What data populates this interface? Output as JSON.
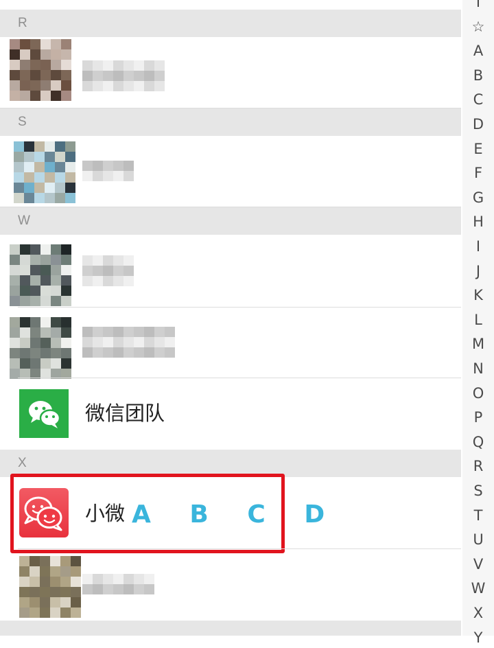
{
  "sections": [
    {
      "letter": "R"
    },
    {
      "letter": "S"
    },
    {
      "letter": "W"
    },
    {
      "letter": "X"
    }
  ],
  "contacts": {
    "wechat_team": {
      "name": "微信团队"
    },
    "xiaowei": {
      "name": "小微",
      "overlay": "A B C D"
    }
  },
  "index_bar": {
    "letters": [
      "I",
      "☆",
      "A",
      "B",
      "C",
      "D",
      "E",
      "F",
      "G",
      "H",
      "I",
      "J",
      "K",
      "L",
      "M",
      "N",
      "O",
      "P",
      "Q",
      "R",
      "S",
      "T",
      "U",
      "V",
      "W",
      "X",
      "Y"
    ]
  },
  "colors": {
    "wechat_green": "#2aae46",
    "xiaowei_red": "#ee3a45",
    "highlight_border": "#e1141e",
    "overlay_blue": "#3ab5dc",
    "section_bg": "#e6e6e6"
  },
  "icons": {
    "wechat_team": "wechat-chat-bubbles-icon",
    "xiaowei": "smiley-chat-bubbles-icon",
    "favorites": "star-icon"
  }
}
